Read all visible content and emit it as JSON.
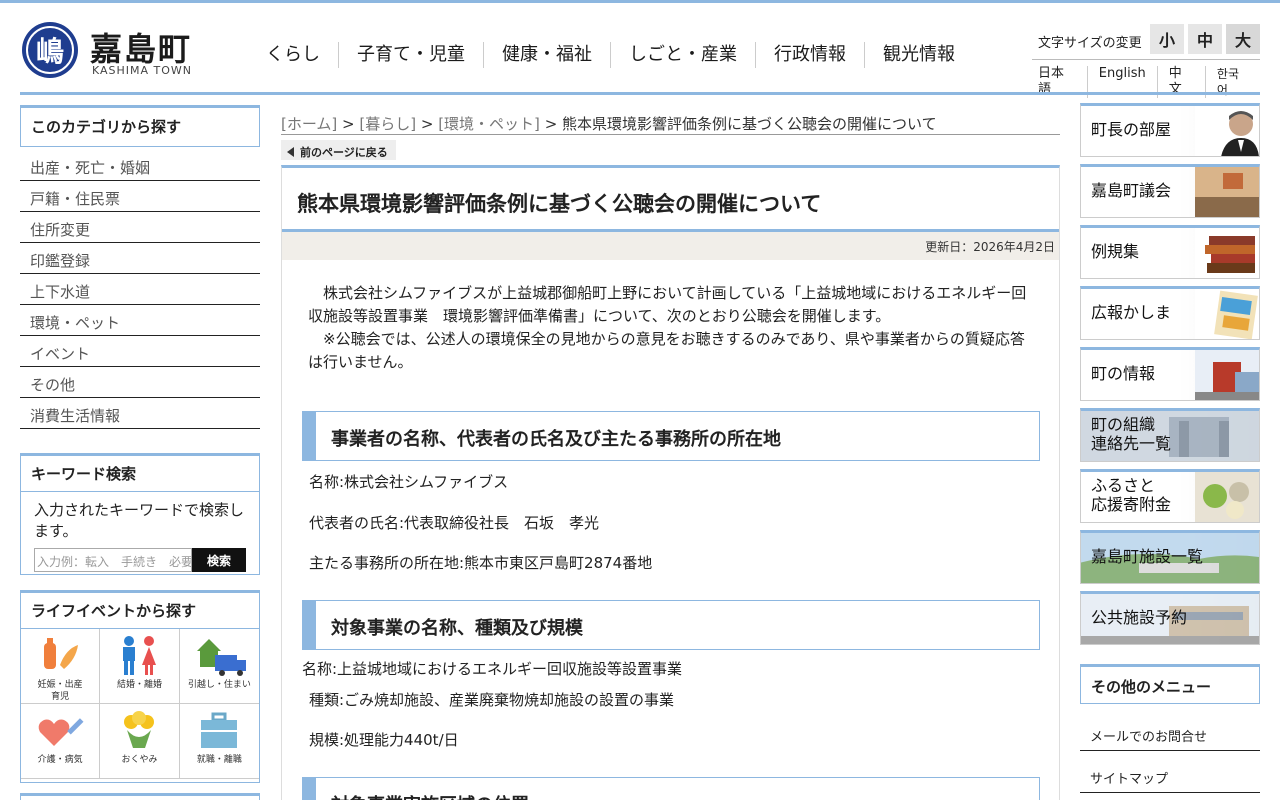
{
  "header": {
    "logo_glyph": "嶋",
    "title": "嘉島町",
    "subtitle": "KASHIMA TOWN",
    "nav": [
      "くらし",
      "子育て・児童",
      "健康・福祉",
      "しごと・産業",
      "行政情報",
      "観光情報"
    ],
    "font_size_label": "文字サイズの変更",
    "font_sizes": [
      "小",
      "中",
      "大"
    ],
    "languages": [
      "日本語",
      "English",
      "中文",
      "한국어"
    ]
  },
  "sidebar": {
    "category_head": "このカテゴリから探す",
    "categories": [
      "出産・死亡・婚姻",
      "戸籍・住民票",
      "住所変更",
      "印鑑登録",
      "上下水道",
      "環境・ペット",
      "イベント",
      "その他",
      "消費生活情報"
    ],
    "keyword_head": "キーワード検索",
    "keyword_desc": "入力されたキーワードで検索します。",
    "keyword_placeholder": "入力例：転入　手続き　必要なもの",
    "keyword_button": "検索",
    "life_head": "ライフイベントから探す",
    "life_events": [
      {
        "label": "妊娠・出産\n育児",
        "icon": "baby-bottle-icon"
      },
      {
        "label": "結婚・離婚",
        "icon": "couple-icon"
      },
      {
        "label": "引越し・住まい",
        "icon": "house-truck-icon"
      },
      {
        "label": "介護・病気",
        "icon": "heart-syringe-icon"
      },
      {
        "label": "おくやみ",
        "icon": "flower-icon"
      },
      {
        "label": "就職・離職",
        "icon": "briefcase-icon"
      }
    ]
  },
  "breadcrumb": {
    "home": "[ホーム]",
    "living": "[暮らし]",
    "env": "[環境・ペット]",
    "sep": " > ",
    "current": "熊本県環境影響評価条例に基づく公聴会の開催について"
  },
  "back_button": "前のページに戻る",
  "article": {
    "title": "熊本県環境影響評価条例に基づく公聴会の開催について",
    "updated": "更新日：2026年4月2日",
    "intro_1": "株式会社シムファイブスが上益城郡御船町上野において計画している「上益城地域におけるエネルギー回収施設等設置事業　環境影響評価準備書」について、次のとおり公聴会を開催します。",
    "intro_2": "※公聴会では、公述人の環境保全の見地からの意見をお聴きするのみであり、県や事業者からの質疑応答は行いません。",
    "section_1": "事業者の名称、代表者の氏名及び主たる事務所の所在地",
    "s1_name": "名称:株式会社シムファイブス",
    "s1_rep": "代表者の氏名:代表取締役社長　石坂　孝光",
    "s1_addr": "主たる事務所の所在地:熊本市東区戸島町2874番地",
    "section_2": "対象事業の名称、種類及び規模",
    "s2_name": "名称:上益城地域におけるエネルギー回収施設等設置事業",
    "s2_type": "種類:ごみ焼却施設、産業廃棄物焼却施設の設置の事業",
    "s2_scale": "規模:処理能力440t/日",
    "section_3": "対象事業実施区域の位置"
  },
  "right_banners": [
    {
      "label": "町長の部屋",
      "key": "mayor"
    },
    {
      "label": "嘉島町議会",
      "key": "council"
    },
    {
      "label": "例規集",
      "key": "books"
    },
    {
      "label": "広報かしま",
      "key": "magazine"
    },
    {
      "label": "町の情報",
      "key": "town"
    },
    {
      "label": "町の組織\n連絡先一覧",
      "key": "org"
    },
    {
      "label": "ふるさと\n応援寄附金",
      "key": "furusato"
    },
    {
      "label": "嘉島町施設一覧",
      "key": "facilities"
    },
    {
      "label": "公共施設予約",
      "key": "reserve"
    }
  ],
  "other_menu": {
    "head": "その他のメニュー",
    "items": [
      "メールでのお問合せ",
      "サイトマップ"
    ]
  }
}
